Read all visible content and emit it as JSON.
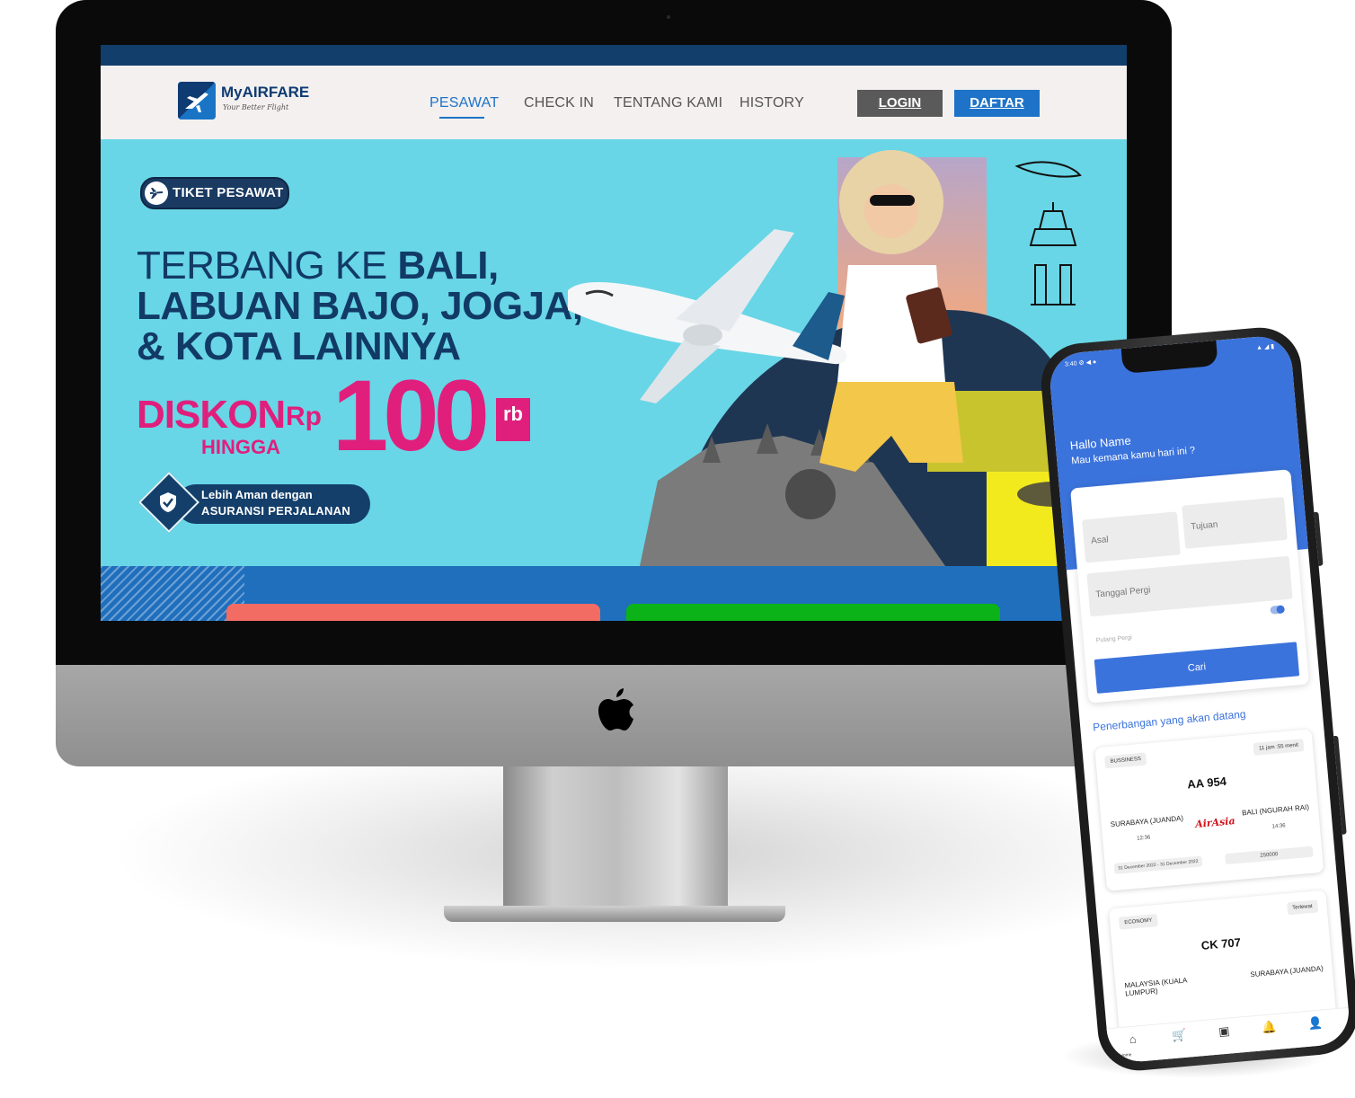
{
  "brand": {
    "name": "MyAIRFARE",
    "tagline": "Your Better Flight"
  },
  "nav": {
    "links": [
      "PESAWAT",
      "CHECK IN",
      "TENTANG KAMI",
      "HISTORY"
    ],
    "active": "PESAWAT",
    "login_label": "LOGIN",
    "daftar_label": "DAFTAR"
  },
  "hero": {
    "pill_label": "TIKET PESAWAT",
    "headline_lite": "TERBANG KE ",
    "headline_bold_1": "BALI,",
    "headline_line_2": "LABUAN BAJO, JOGJA,",
    "headline_line_3": "& KOTA LAINNYA",
    "diskon": "DISKON",
    "hingga": "HINGGA",
    "rp": "Rp",
    "amount": "100",
    "unit": "rb",
    "insurance_line_1": "Lebih Aman dengan",
    "insurance_line_2": "ASURANSI PERJALANAN"
  },
  "colors": {
    "brand_blue": "#1e73c8",
    "navy": "#123a66",
    "pink": "#e01f7d",
    "hero_cyan": "#68d6e6",
    "card_red": "#f36c63",
    "card_green": "#0bb318",
    "app_blue": "#3b73dc"
  },
  "icons": {
    "plane": "plane-icon",
    "shield": "shield-check-icon",
    "apple": "apple-logo",
    "home": "home-icon",
    "cart": "cart-icon",
    "ticket": "ticket-icon",
    "bell": "bell-icon",
    "user": "user-icon"
  },
  "mobile": {
    "greeting": "Hallo Name",
    "question": "Mau kemana kamu hari ini ?",
    "asal_placeholder": "Asal",
    "tujuan_placeholder": "Tujuan",
    "tanggal_placeholder": "Tanggal Pergi",
    "pulang_label": "Pulang Pergi",
    "cari_label": "Cari",
    "upcoming_title": "Penerbangan yang akan datang",
    "trips": [
      {
        "class": "BUSSINESS",
        "duration": "11 jam :55 menit",
        "code": "AA 954",
        "from": "SURABAYA (JUANDA)",
        "from_time": "12:36",
        "airline": "AirAsia",
        "to": "BALI (NGURAH RAI)",
        "to_time": "14:36",
        "dates": "31 December 2022 - 31 December 2022",
        "price": "250000"
      },
      {
        "class": "ECONOMY",
        "duration": "Terlewat",
        "code": "CK 707",
        "from": "MALAYSIA (KUALA LUMPUR)",
        "to": "SURABAYA (JUANDA)"
      }
    ],
    "tab_home_label": "Home"
  }
}
